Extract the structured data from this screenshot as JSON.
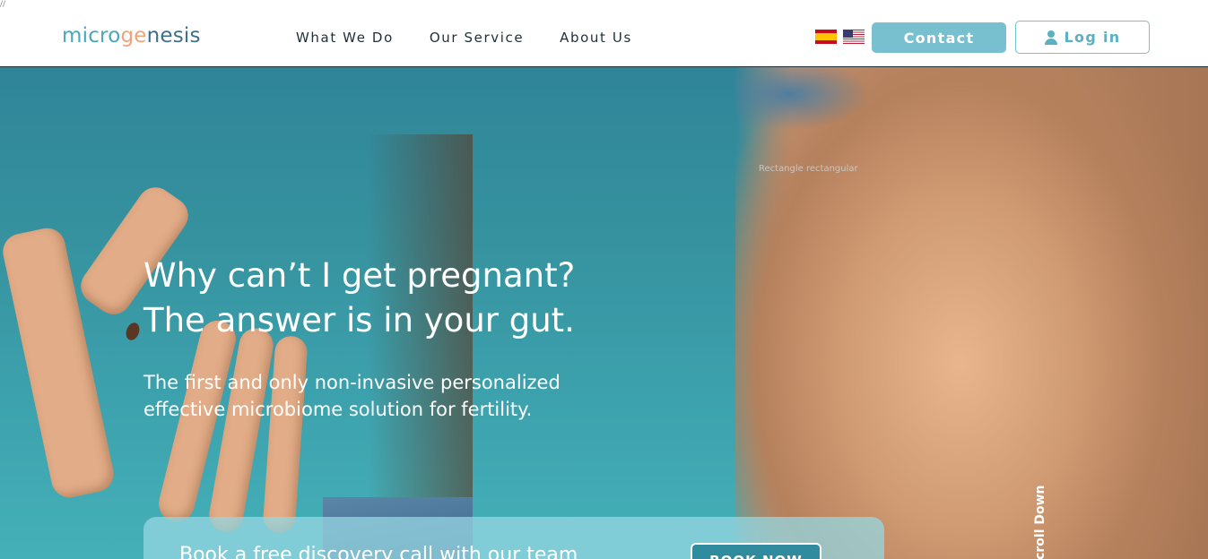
{
  "corner_mark": "//",
  "header": {
    "logo": {
      "part1": "micro",
      "part2": "ge",
      "part3": "nesis"
    },
    "nav": [
      "What We Do",
      "Our Service",
      "About Us"
    ],
    "flags": [
      {
        "icon": "spain-flag-icon",
        "label": "ES"
      },
      {
        "icon": "usa-flag-icon",
        "label": "EN"
      }
    ],
    "contact_label": "Contact",
    "login_label": "Log in"
  },
  "hero": {
    "faint_label": "Rectangle rectangular",
    "headline_line1": "Why can’t I get pregnant?",
    "headline_line2": "The answer is in your gut.",
    "subhead_line1": "The first and only non-invasive personalized",
    "subhead_line2": "effective microbiome solution for fertility.",
    "cta_text": "Book a free discovery call with our team",
    "cta_button": "BOOK NOW",
    "scroll_label": "Scroll Down"
  },
  "colors": {
    "accent": "#78c0cf",
    "hero_top": "#2f8598",
    "hero_bottom": "#45b0b8",
    "logo_blue": "#47a9bb",
    "logo_orange": "#f0a37c",
    "nav_text": "#1f2f3a"
  }
}
